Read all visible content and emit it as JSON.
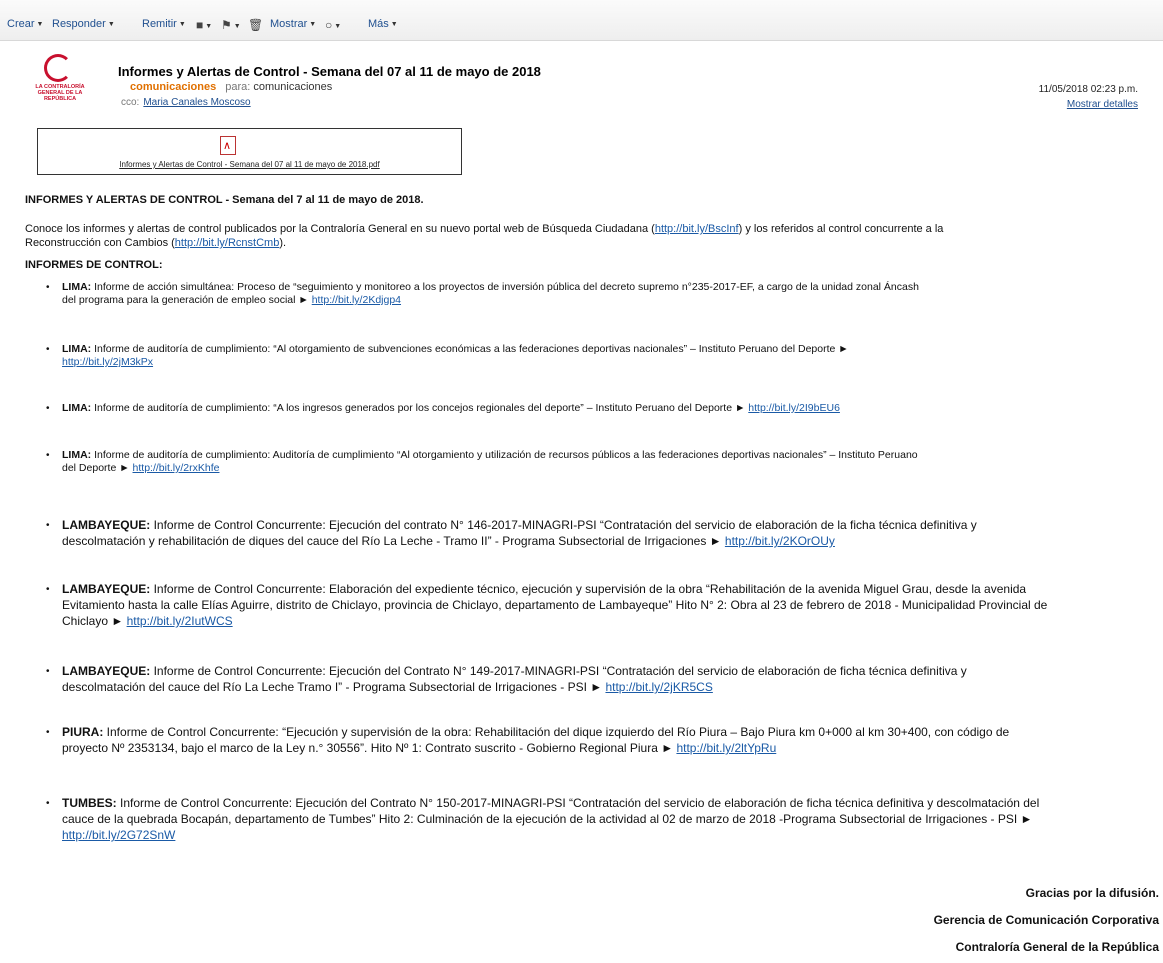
{
  "toolbar": {
    "crear": "Crear",
    "responder": "Responder",
    "remitir": "Remitir",
    "mostrar": "Mostrar",
    "mas": "Más"
  },
  "header": {
    "logo_text": "LA CONTRALORÍA GENERAL DE LA REPÚBLICA",
    "subject": "Informes y Alertas de Control - Semana del 07 al 11 de mayo de 2018",
    "sender": "comunicaciones",
    "para_label": "para:",
    "recipient": "comunicaciones",
    "cco_label": "cco:",
    "cco_name": "Maria Canales Moscoso",
    "date": "11/05/2018 02:23 p.m.",
    "details": "Mostrar detalles"
  },
  "attachment": {
    "filename": "Informes y Alertas de Control - Semana del 07 al 11 de mayo de 2018.pdf"
  },
  "body": {
    "heading": "INFORMES Y ALERTAS DE CONTROL - Semana del 7 al 11 de mayo de 2018.",
    "intro_a": "Conoce los informes y alertas de control publicados por la Contraloría General en su nuevo portal web de Búsqueda Ciudadana (",
    "intro_link1": "http://bit.ly/BscInf",
    "intro_b": ") y los referidos al control concurrente a la",
    "intro_c": "Reconstrucción con Cambios (",
    "intro_link2": "http://bit.ly/RcnstCmb",
    "intro_d": ").",
    "section_title": "INFORMES DE CONTROL:",
    "items": [
      {
        "region": "LIMA:",
        "line1": " Informe de acción simultánea: Proceso de “seguimiento y monitoreo a los proyectos de inversión pública del decreto supremo n°235-2017-EF, a cargo de la unidad zonal Áncash",
        "line2": "del programa para la generación de empleo social ► ",
        "line3": "",
        "link": "http://bit.ly/2Kdjgp4"
      },
      {
        "region": "LIMA:",
        "line1": " Informe de auditoría de cumplimiento: “Al otorgamiento de subvenciones económicas a las federaciones deportivas nacionales” – Instituto Peruano del Deporte ►",
        "line2": "",
        "line3": "",
        "link": "http://bit.ly/2jM3kPx"
      },
      {
        "region": "LIMA:",
        "line1": " Informe de auditoría de cumplimiento: “A los ingresos generados por los concejos regionales del deporte” – Instituto Peruano del Deporte ► ",
        "line2": "",
        "line3": "",
        "link": "http://bit.ly/2I9bEU6"
      },
      {
        "region": "LIMA:",
        "line1": " Informe de auditoría de cumplimiento: Auditoría de cumplimiento “Al otorgamiento y utilización de recursos públicos a las federaciones deportivas nacionales” – Instituto Peruano",
        "line2": "del Deporte ► ",
        "line3": "",
        "link": "http://bit.ly/2rxKhfe"
      },
      {
        "region": "LAMBAYEQUE:",
        "line1": " Informe de Control Concurrente: Ejecución del contrato N° 146-2017-MINAGRI-PSI “Contratación del servicio de elaboración de la ficha técnica definitiva y",
        "line2": "descolmatación y rehabilitación de diques del cauce del Río La Leche - Tramo II” - Programa Subsectorial de Irrigaciones ► ",
        "line3": "",
        "link": "http://bit.ly/2KOrOUy"
      },
      {
        "region": "LAMBAYEQUE:",
        "line1": " Informe de Control Concurrente: Elaboración del expediente técnico, ejecución y supervisión de la obra “Rehabilitación de la avenida Miguel Grau, desde la avenida",
        "line2": "Evitamiento hasta la calle Elías Aguirre, distrito de Chiclayo, provincia de Chiclayo, departamento de Lambayeque” Hito N° 2: Obra al 23 de febrero de 2018 - Municipalidad Provincial de",
        "line3": "Chiclayo ► ",
        "link": "http://bit.ly/2IutWCS"
      },
      {
        "region": "LAMBAYEQUE:",
        "line1": " Informe de Control Concurrente: Ejecución del Contrato N° 149-2017-MINAGRI-PSI “Contratación del servicio de elaboración de ficha técnica definitiva y",
        "line2": "descolmatación del cauce del Río La Leche Tramo I” - Programa Subsectorial de Irrigaciones - PSI ► ",
        "line3": "",
        "link": "http://bit.ly/2jKR5CS"
      },
      {
        "region": "PIURA:",
        "line1": " Informe de Control Concurrente: “Ejecución y supervisión de la obra: Rehabilitación del dique izquierdo del Río Piura – Bajo Piura km 0+000 al km 30+400, con código de",
        "line2": "proyecto  Nº 2353134, bajo el marco de la Ley n.° 30556”. Hito Nº 1: Contrato suscrito - Gobierno Regional Piura ► ",
        "line3": "",
        "link": "http://bit.ly/2ltYpRu"
      },
      {
        "region": "TUMBES:",
        "line1": " Informe de Control Concurrente: Ejecución del Contrato N° 150-2017-MINAGRI-PSI “Contratación del servicio de elaboración de ficha técnica definitiva y descolmatación del",
        "line2": "cauce de la quebrada Bocapán, departamento de Tumbes” Hito 2: Culminación de la ejecución de la actividad al 02 de marzo de 2018 -Programa Subsectorial de Irrigaciones - PSI ►",
        "line3": "",
        "link": "http://bit.ly/2G72SnW"
      }
    ]
  },
  "signature": {
    "line1": "Gracias por la difusión.",
    "line2": "Gerencia de Comunicación Corporativa",
    "line3": "Contraloría General de la República"
  }
}
